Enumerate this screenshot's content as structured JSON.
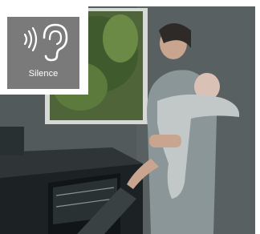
{
  "badge": {
    "icon": "ear-sound-icon",
    "label": "Silence",
    "background_color": "#7a7a7a",
    "text_color": "#ffffff"
  },
  "photo": {
    "subject": "kitchen-scene-photo"
  }
}
